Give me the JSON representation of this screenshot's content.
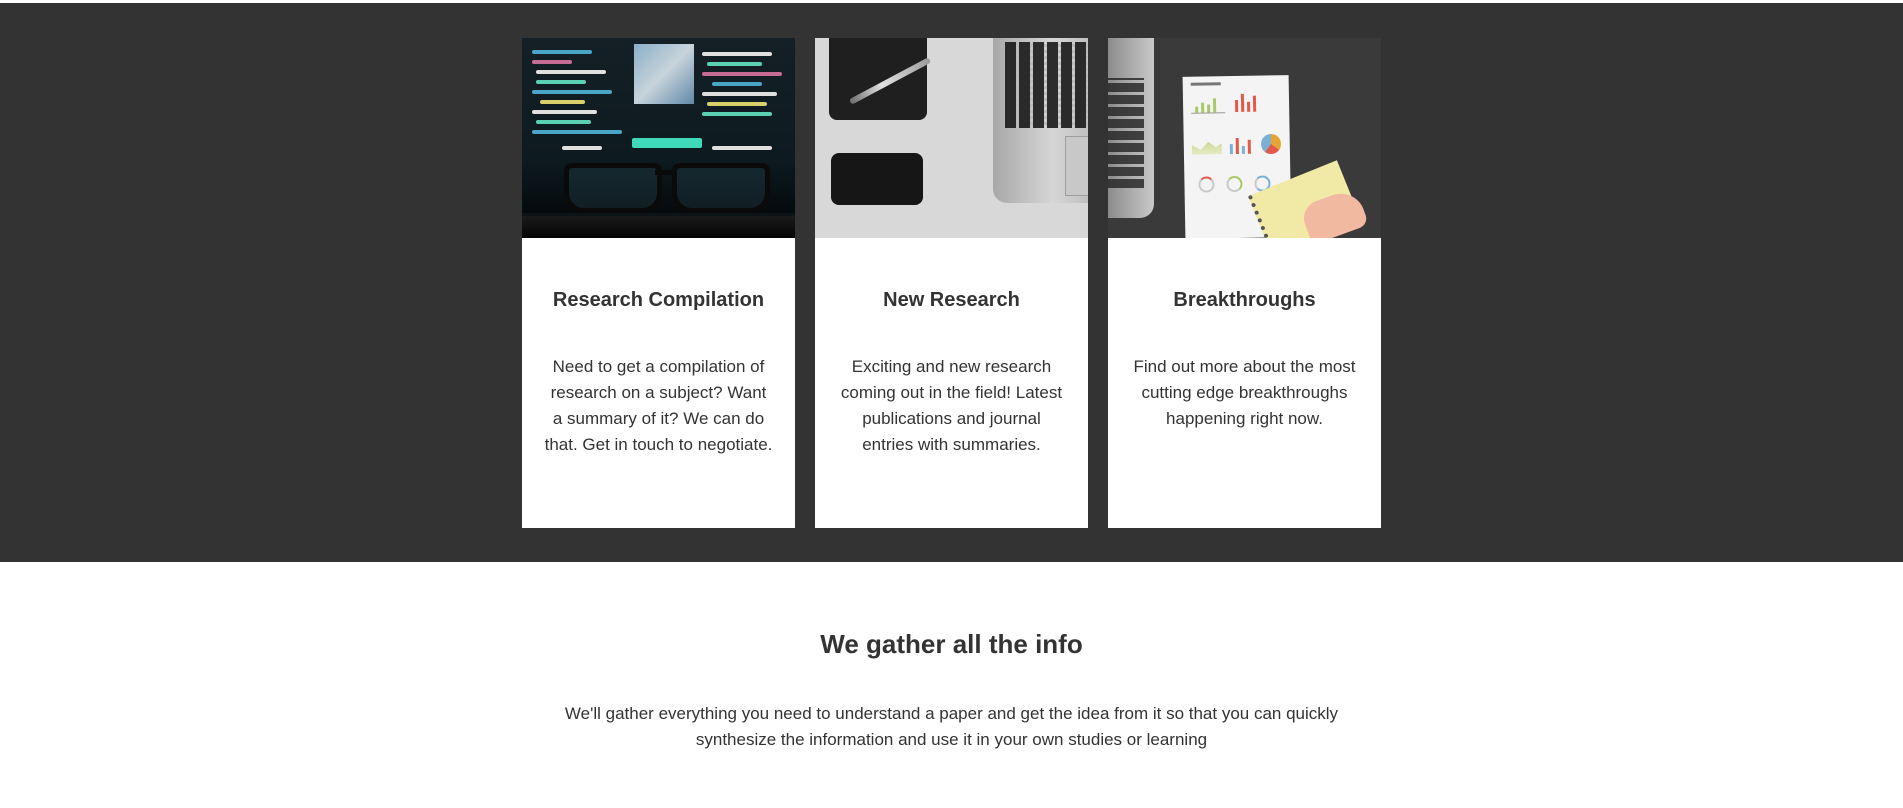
{
  "services": {
    "cards": [
      {
        "image": "code-screen-with-glasses-image",
        "title": "Research Compilation",
        "text": "Need to get a compilation of research on a subject? Want a summary of it? We can do that. Get in touch to negotiate."
      },
      {
        "image": "desk-notebook-laptop-image",
        "title": "New Research",
        "text": "Exciting and new research coming out in the field! Latest publications and journal entries with summaries."
      },
      {
        "image": "laptop-charts-notepad-image",
        "title": "Breakthroughs",
        "text": "Find out more about the most cutting edge breakthroughs happening right now."
      }
    ],
    "background_color": "#333333",
    "card_color": "#ffffff"
  },
  "info": {
    "title": "We gather all the info",
    "text": "We'll gather everything you need to understand a paper and get the idea from it so that you can quickly synthesize the information and use it in your own studies or learning"
  }
}
